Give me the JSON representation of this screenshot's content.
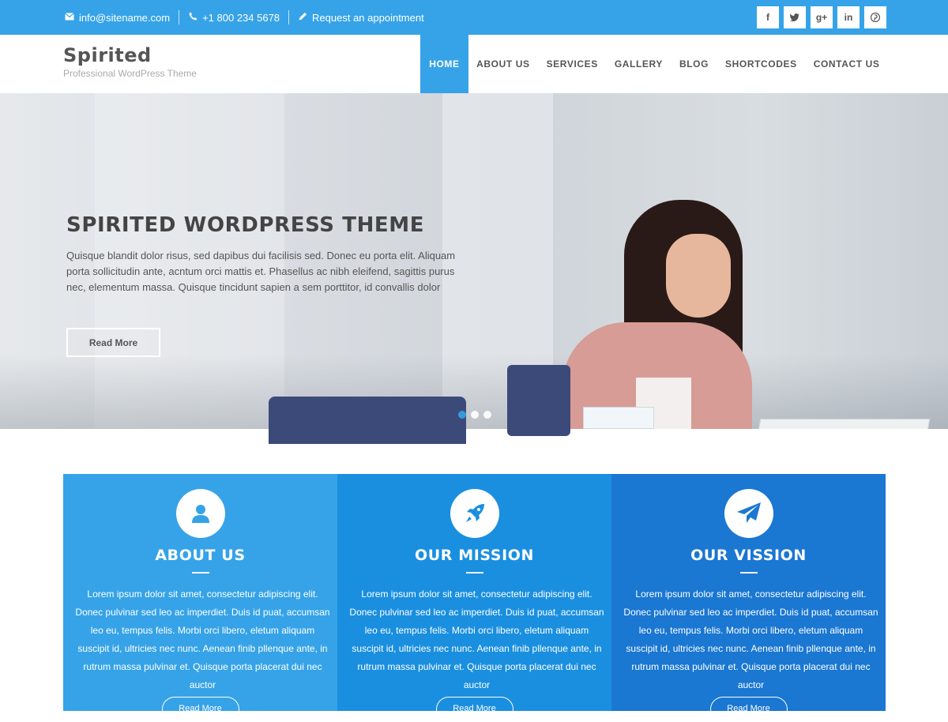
{
  "topbar": {
    "email": "info@sitename.com",
    "phone": "+1 800 234 5678",
    "appointment": "Request an appointment",
    "socials": [
      {
        "name": "facebook-icon",
        "glyph": "f"
      },
      {
        "name": "twitter-icon",
        "glyph": "t"
      },
      {
        "name": "google-plus-icon",
        "glyph": "g+"
      },
      {
        "name": "linkedin-icon",
        "glyph": "in"
      },
      {
        "name": "pinterest-icon",
        "glyph": "p"
      }
    ]
  },
  "header": {
    "logo": "Spirited",
    "tagline": "Professional WordPress Theme",
    "nav": [
      "HOME",
      "ABOUT US",
      "SERVICES",
      "GALLERY",
      "BLOG",
      "SHORTCODES",
      "CONTACT US"
    ]
  },
  "hero": {
    "title": "SPIRITED WORDPRESS THEME",
    "body": "Quisque blandit dolor risus, sed dapibus dui facilisis sed. Donec eu porta elit. Aliquam porta sollicitudin ante, acntum orci mattis et. Phasellus ac nibh eleifend, sagittis purus nec, elementum massa. Quisque tincidunt sapien a sem porttitor, id convallis dolor",
    "button": "Read More",
    "active_slide": 1
  },
  "features": [
    {
      "icon": "user-icon",
      "title": "ABOUT US",
      "text": "Lorem ipsum dolor sit amet, consectetur adipiscing elit. Donec pulvinar sed leo ac imperdiet. Duis id puat, accumsan leo eu, tempus felis. Morbi orci libero, eletum aliquam suscipit id, ultricies nec nunc. Aenean finib pllenque ante, in rutrum massa pulvinar et. Quisque porta placerat dui nec auctor",
      "button": "Read More"
    },
    {
      "icon": "rocket-icon",
      "title": "OUR MISSION",
      "text": "Lorem ipsum dolor sit amet, consectetur adipiscing elit. Donec pulvinar sed leo ac imperdiet. Duis id puat, accumsan leo eu, tempus felis. Morbi orci libero, eletum aliquam suscipit id, ultricies nec nunc. Aenean finib pllenque ante, in rutrum massa pulvinar et. Quisque porta placerat dui nec auctor",
      "button": "Read More"
    },
    {
      "icon": "paper-plane-icon",
      "title": "OUR VISSION",
      "text": "Lorem ipsum dolor sit amet, consectetur adipiscing elit. Donec pulvinar sed leo ac imperdiet. Duis id puat, accumsan leo eu, tempus felis. Morbi orci libero, eletum aliquam suscipit id, ultricies nec nunc. Aenean finib pllenque ante, in rutrum massa pulvinar et. Quisque porta placerat dui nec auctor",
      "button": "Read More"
    }
  ],
  "colors": {
    "accent": "#36a3e8",
    "feature_1": "#36a3e8",
    "feature_2": "#1a8fe0",
    "feature_3": "#1a77d2"
  }
}
